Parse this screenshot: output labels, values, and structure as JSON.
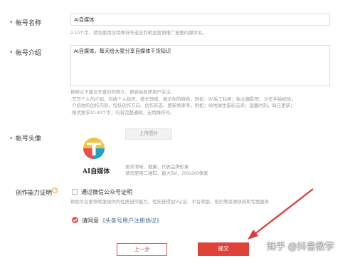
{
  "form": {
    "name": {
      "label": "帐号名称",
      "value": "AI自媒体",
      "hint": "2-10个字，请勿使用含特殊符号或含有明显营销推广意图的媒体名。"
    },
    "intro": {
      "label": "帐号介绍",
      "value": "AI自媒体，每天给大家分享自媒体干货知识",
      "suggestions": [
        "按照以下建议丰富你的简介，更容易收获用户关注：",
        "·写写个人的介绍，包括个人经历、擅长领域、展示你的特色，例如：90后工科男；独立摄影师；10年手绘经验；",
        "·介绍你的创作内容，包括创作方向、创作形态、更新频率等，例如：给地球生猫彩击杀；温趣时刻，每日更新；",
        "·格式要求10-30个字，内容完整通顺，无特殊符号。"
      ]
    },
    "avatar": {
      "label": "帐号头像",
      "upload_label": "上传图片",
      "logo_text": "AI自媒体",
      "hints": [
        "要求清晰、健康，代表品牌形象",
        "请勿使用二维码，最大5M，200x200像素"
      ]
    },
    "capability": {
      "label": "创作能力证明",
      "help_icon": "question-circle-icon",
      "checkbox_label": "通过微信公众号证明",
      "desc": "帮助平台更快地发现你的优质创作能力，优先获得加V认证、平台奖励、签约等资源扶持和专属服务"
    },
    "agreement": {
      "prefix": "请同意",
      "link": "《头条号用户注册协议》"
    }
  },
  "buttons": {
    "prev": "上一步",
    "submit": "提交"
  },
  "watermark": "知乎 @抖音教学",
  "colors": {
    "accent": "#e0574f",
    "submit_bg": "#e0423a",
    "arrow": "#e03a32"
  }
}
